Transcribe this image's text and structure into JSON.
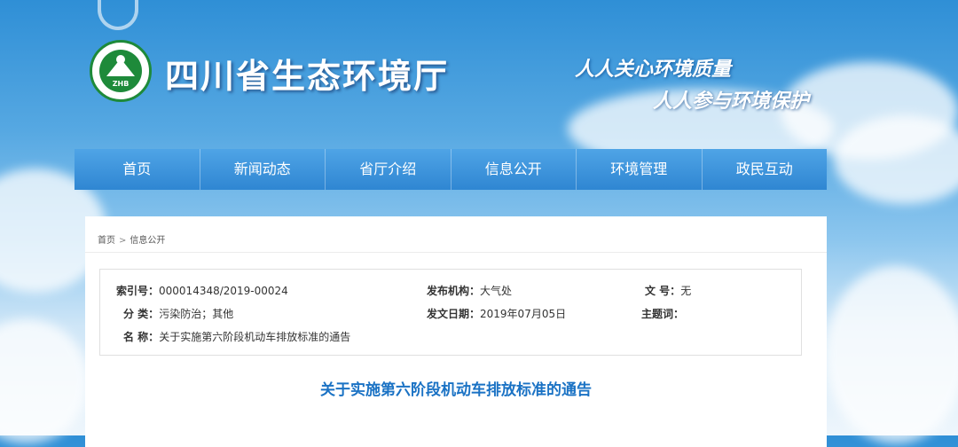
{
  "header": {
    "site_title": "四川省生态环境厅",
    "logo_text": "ZHB",
    "slogan_line1": "人人关心环境质量",
    "slogan_line2": "人人参与环境保护"
  },
  "nav": {
    "items": [
      "首页",
      "新闻动态",
      "省厅介绍",
      "信息公开",
      "环境管理",
      "政民互动"
    ]
  },
  "breadcrumb": {
    "home": "首页",
    "separator": ">",
    "current": "信息公开"
  },
  "meta": {
    "index_label": "索引号：",
    "index_value": "000014348/2019-00024",
    "org_label": "发布机构：",
    "org_value": "大气处",
    "docno_label": "文 号：",
    "docno_value": "无",
    "category_label": "分 类：",
    "category_value": "污染防治；其他",
    "date_label": "发文日期：",
    "date_value": "2019年07月05日",
    "subject_label": "主题词：",
    "subject_value": "",
    "name_label": "名 称：",
    "name_value": "关于实施第六阶段机动车排放标准的通告"
  },
  "document": {
    "title": "关于实施第六阶段机动车排放标准的通告"
  },
  "colors": {
    "nav_bg": "#3a92dc",
    "title_blue": "#1a72c4",
    "logo_green": "#1e8a3a"
  }
}
